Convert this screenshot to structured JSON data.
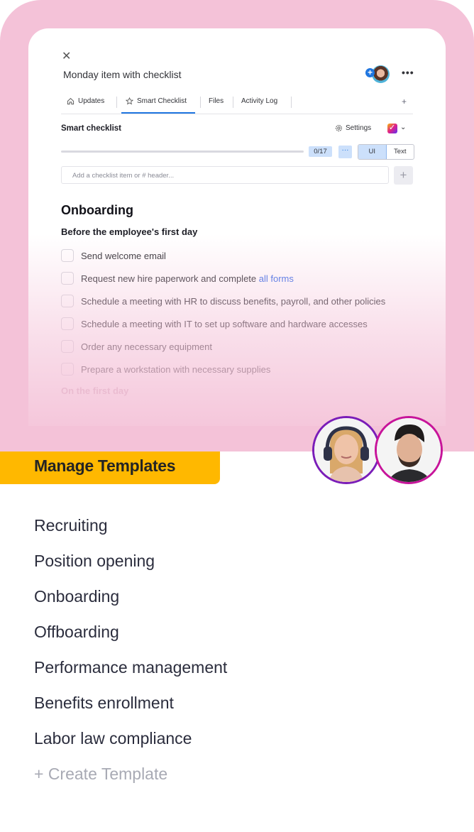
{
  "item_panel": {
    "title": "Monday item with checklist",
    "icons": {
      "close": "close-icon",
      "add_user": "plus-circle-icon",
      "more": "more-horizontal-icon"
    },
    "more_label": "•••",
    "tabs": [
      {
        "label": "Updates",
        "icon": "home-icon",
        "active": false
      },
      {
        "label": "Smart Checklist",
        "icon": "star-icon",
        "active": true
      },
      {
        "label": "Files",
        "active": false
      },
      {
        "label": "Activity Log",
        "active": false
      }
    ],
    "add_tab_label": "+"
  },
  "checklist": {
    "title": "Smart checklist",
    "settings_label": "Settings",
    "progress": {
      "done": 0,
      "total": 17,
      "label": "0/17",
      "fraction": 0.0
    },
    "more_label": "···",
    "view_modes": [
      {
        "label": "UI",
        "active": true
      },
      {
        "label": "Text",
        "active": false
      }
    ],
    "input_placeholder": "Add a checklist item or # header...",
    "add_button_label": "+",
    "section_title": "Onboarding",
    "groups": [
      {
        "title": "Before the employee's first day",
        "items": [
          {
            "text": "Send welcome email",
            "checked": false
          },
          {
            "text": "Request new hire paperwork and complete ",
            "link": "all forms",
            "checked": false
          },
          {
            "text": "Schedule a meeting with HR to discuss benefits, payroll, and other policies",
            "checked": false
          },
          {
            "text": "Schedule a meeting with IT to set up software and hardware accesses",
            "checked": false
          },
          {
            "text": "Order any necessary equipment",
            "checked": false
          },
          {
            "text": "Prepare a workstation with necessary supplies",
            "checked": false
          }
        ]
      },
      {
        "title": "On the first day",
        "items": []
      }
    ]
  },
  "manage_templates": {
    "title": "Manage Templates",
    "accent_color": "#ffb800",
    "templates": [
      "Recruiting",
      "Position opening",
      "Onboarding",
      "Offboarding",
      "Performance management",
      "Benefits enrollment",
      "Labor law compliance"
    ],
    "create_label": "+ Create Template"
  },
  "colors": {
    "hero_bg": "#f4c2d8",
    "primary": "#1f76e0",
    "link": "#3b6ee8"
  }
}
